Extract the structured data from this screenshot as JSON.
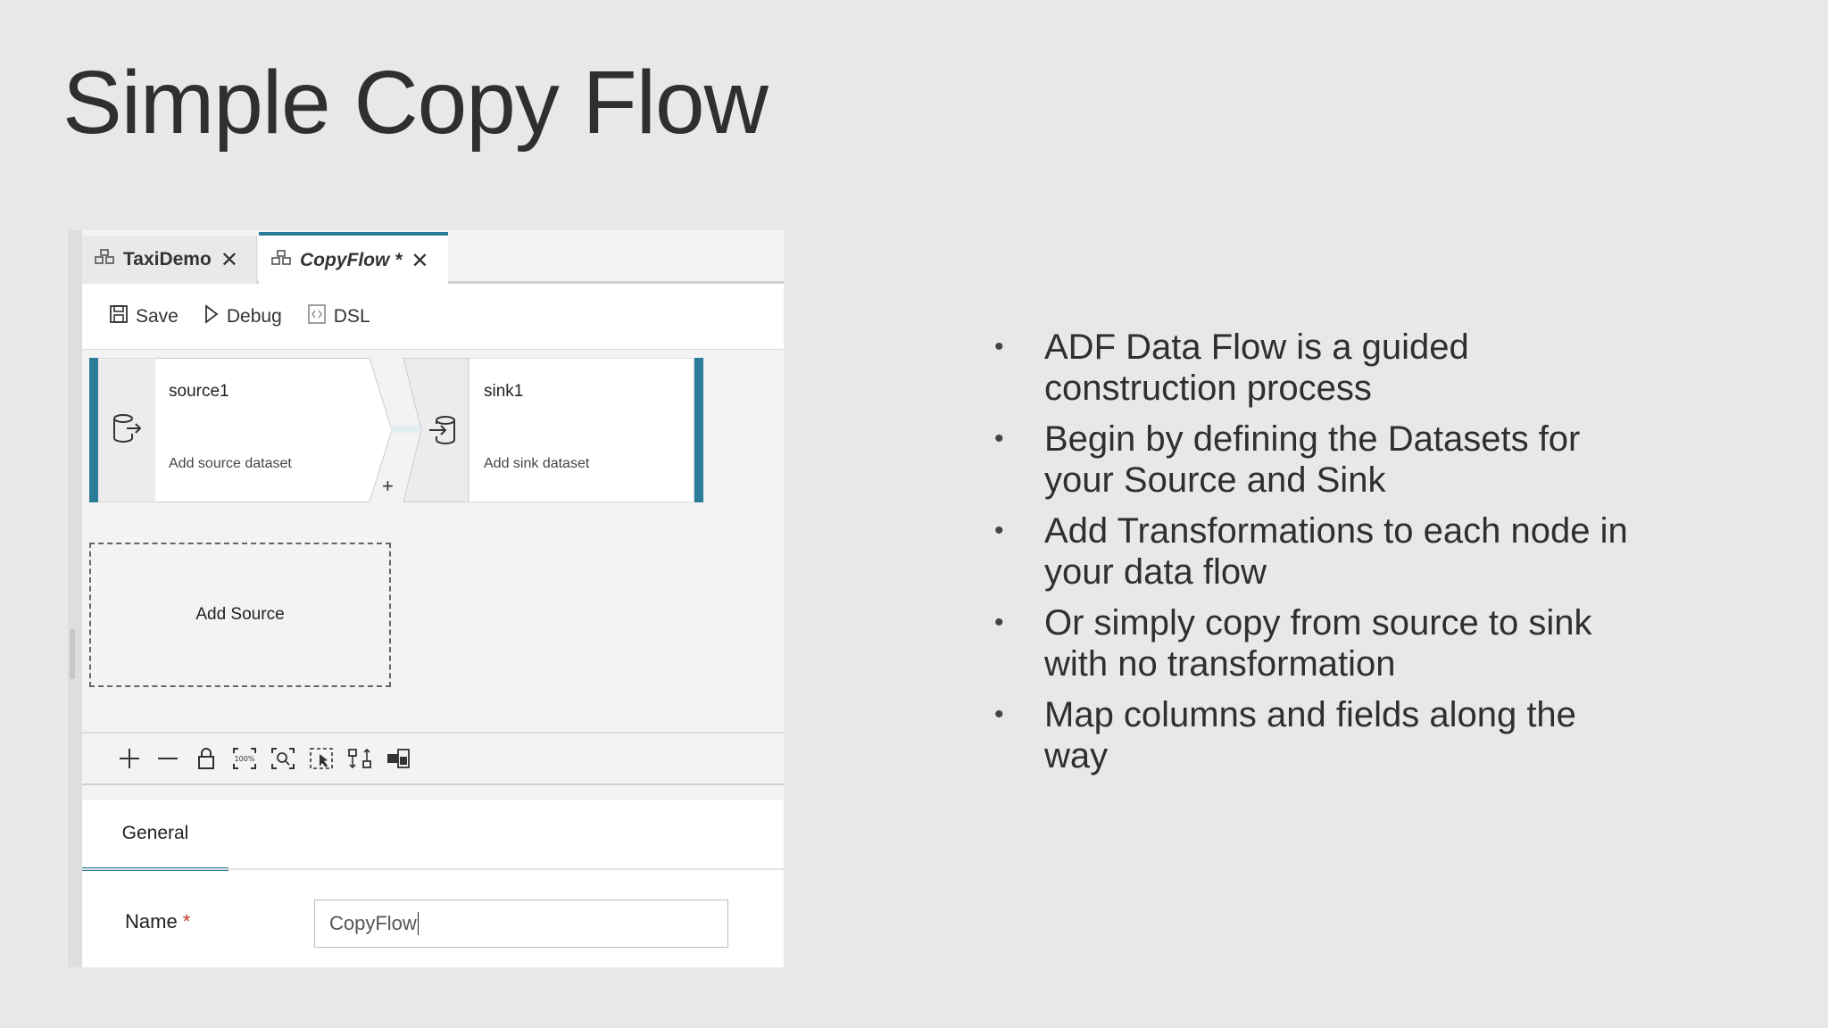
{
  "slide": {
    "title": "Simple Copy Flow",
    "bullets": [
      "ADF Data Flow is a guided construction process",
      "Begin by defining the Datasets for your Source and Sink",
      "Add Transformations to each node in your data flow",
      "Or simply copy from source to sink with no transformation",
      "Map columns and fields along the way"
    ]
  },
  "screenshot": {
    "tabs": [
      {
        "label": "TaxiDemo",
        "icon": "dataflow-icon",
        "close_icon": "close-icon",
        "active": false
      },
      {
        "label": "CopyFlow *",
        "icon": "dataflow-icon",
        "close_icon": "close-icon",
        "active": true
      }
    ],
    "toolbar": {
      "save_label": "Save",
      "debug_label": "Debug",
      "dsl_label": "DSL"
    },
    "source_node": {
      "name": "source1",
      "subtitle": "Add source dataset",
      "icon": "source-icon"
    },
    "sink_node": {
      "name": "sink1",
      "subtitle": "Add sink dataset",
      "icon": "sink-icon"
    },
    "add_transform_symbol": "+",
    "add_source_label": "Add Source",
    "zoom_toolbar": [
      "zoom-in-icon",
      "zoom-out-icon",
      "lock-icon",
      "zoom-100-icon",
      "zoom-to-fit-icon",
      "select-icon",
      "auto-align-icon",
      "minimap-icon"
    ],
    "properties": {
      "tab_label": "General",
      "name_label": "Name",
      "required_marker": "*",
      "name_value": "CopyFlow"
    },
    "colors": {
      "accent": "#2b7b9a",
      "background": "#e8e8e9"
    }
  }
}
